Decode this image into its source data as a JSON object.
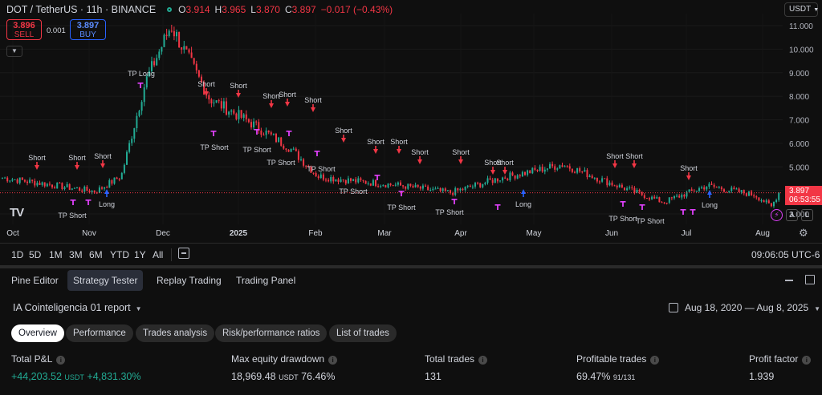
{
  "legend": {
    "title": "DOT / TetherUS · 11h · BINANCE",
    "o_label": "O",
    "o": "3.914",
    "h_label": "H",
    "h": "3.965",
    "l_label": "L",
    "l": "3.870",
    "c_label": "C",
    "c": "3.897",
    "change": "−0.017 (−0.43%)"
  },
  "trade_buttons": {
    "sell_price": "3.896",
    "sell_label": "SELL",
    "spread": "0.001",
    "buy_price": "3.897",
    "buy_label": "BUY"
  },
  "currency": "USDT",
  "logo_text": "TV",
  "price_axis": {
    "ticks": [
      "11.000",
      "10.000",
      "9.000",
      "8.000",
      "7.000",
      "6.000",
      "5.000",
      "4.000",
      "3.000"
    ],
    "current_price": "3.897",
    "countdown": "06:53:55"
  },
  "time_axis": {
    "labels": [
      "Oct",
      "Nov",
      "Dec",
      "2025",
      "Feb",
      "Mar",
      "Apr",
      "May",
      "Jun",
      "Jul",
      "Aug"
    ]
  },
  "axis_buttons": {
    "auto": "A",
    "log": "L"
  },
  "chart_data": {
    "type": "candlestick",
    "timeframe": "11h",
    "symbol": "DOTUSDT",
    "ylim": [
      2.8,
      11.5
    ],
    "current_price": 3.897,
    "grid": true,
    "path_x_labels": [
      "Oct",
      "Nov",
      "Dec",
      "Dec",
      "2025",
      "Feb",
      "Mar",
      "Apr",
      "May",
      "Jun",
      "Jul",
      "Aug",
      "Aug"
    ],
    "path_close_approx": [
      4.55,
      4.25,
      3.95,
      4.6,
      8.6,
      11.0,
      7.9,
      6.9,
      5.8,
      4.6,
      4.4,
      4.2,
      3.9,
      4.5,
      5.1,
      4.3,
      3.5,
      4.2,
      3.8,
      3.3,
      4.3,
      3.9,
      3.85
    ]
  },
  "signals": {
    "short_label": "Short",
    "long_label": "Long",
    "tp_short_label": "TP Short",
    "tp_long_label": "TP Long",
    "short_signals": [
      {
        "x": "Sep",
        "label": "Short"
      },
      {
        "x": "Oct",
        "label": "Short"
      },
      {
        "x": "Nov",
        "label": "Short"
      },
      {
        "x": "Dec",
        "label": "Short"
      },
      {
        "x": "Dec",
        "label": "Short"
      },
      {
        "x": "Jan",
        "label": "Short"
      },
      {
        "x": "Jan",
        "label": "Short"
      },
      {
        "x": "Feb",
        "label": "Short"
      },
      {
        "x": "Feb",
        "label": "Short"
      },
      {
        "x": "Feb",
        "label": "Short"
      },
      {
        "x": "Mar",
        "label": "Short"
      },
      {
        "x": "Apr",
        "label": "Short"
      },
      {
        "x": "Apr",
        "label": "Short"
      },
      {
        "x": "Jun",
        "label": "Short"
      },
      {
        "x": "Jun",
        "label": "Short"
      },
      {
        "x": "Jul",
        "label": "Short"
      },
      {
        "x": "Jul",
        "label": "Short"
      },
      {
        "x": "Aug",
        "label": "Short"
      }
    ],
    "long_signals": [
      {
        "x": "Nov",
        "label": "Long"
      },
      {
        "x": "Apr",
        "label": "Long"
      },
      {
        "x": "Jul",
        "label": "Long"
      }
    ],
    "tp_labels_visible": [
      "TP Short",
      "TP Long",
      "TP Short",
      "TP Short",
      "TP Short",
      "TP Short",
      "TP Short",
      "TP Short",
      "TP Short",
      "TP Short"
    ]
  },
  "range_bar": {
    "buttons": [
      "1D",
      "5D",
      "1M",
      "3M",
      "6M",
      "YTD",
      "1Y",
      "All"
    ],
    "clock": "09:06:05 UTC-6"
  },
  "panel": {
    "tabs": [
      "Pine Editor",
      "Strategy Tester",
      "Replay Trading",
      "Trading Panel"
    ],
    "active_tab": "Strategy Tester",
    "report_title": "IA Cointeligencia 01 report",
    "date_range": "Aug 18, 2020 — Aug 8, 2025",
    "report_tabs": [
      "Overview",
      "Performance",
      "Trades analysis",
      "Risk/performance ratios",
      "List of trades"
    ],
    "active_report_tab": "Overview",
    "metrics": {
      "total_pnl": {
        "label": "Total P&L",
        "value": "+44,203.52",
        "unit": "USDT",
        "pct": "+4,831.30%"
      },
      "max_dd": {
        "label": "Max equity drawdown",
        "value": "18,969.48",
        "unit": "USDT",
        "pct": "76.46%"
      },
      "total_trades": {
        "label": "Total trades",
        "value": "131"
      },
      "profitable": {
        "label": "Profitable trades",
        "value": "69.47%",
        "ratio": "91/131"
      },
      "profit_factor": {
        "label": "Profit factor",
        "value": "1.939"
      }
    }
  },
  "colors": {
    "up": "#22ab94",
    "down": "#f23645",
    "short_arrow": "#f23645",
    "long_arrow": "#2962ff",
    "tp_marker": "#e040fb",
    "background": "#0f0f0f"
  }
}
